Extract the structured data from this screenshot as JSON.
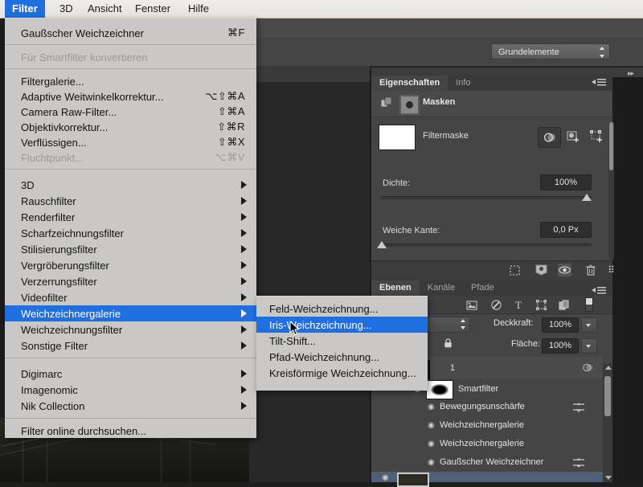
{
  "app": {
    "menubar": [
      {
        "label": "Filter",
        "active": true
      },
      {
        "label": "3D",
        "active": false
      },
      {
        "label": "Ansicht",
        "active": false
      },
      {
        "label": "Fenster",
        "active": false
      },
      {
        "label": "Hilfe",
        "active": false
      }
    ],
    "accent_color": "#1f6fe0",
    "menu_background": "#c9c8c6",
    "panel_background": "#454545"
  },
  "filter_menu": {
    "items": [
      {
        "label": "Gaußscher Weichzeichner",
        "shortcut": "⌘F",
        "submenu": false,
        "disabled": false,
        "selected": false
      },
      {
        "label": "Für Smartfilter konvertieren",
        "shortcut": "",
        "submenu": false,
        "disabled": true,
        "selected": false
      },
      {
        "label": "Filtergalerie...",
        "shortcut": "",
        "submenu": false,
        "disabled": false,
        "selected": false
      },
      {
        "label": "Adaptive Weitwinkelkorrektur...",
        "shortcut": "⌥⇧⌘A",
        "submenu": false,
        "disabled": false,
        "selected": false
      },
      {
        "label": "Camera Raw-Filter...",
        "shortcut": "⇧⌘A",
        "submenu": false,
        "disabled": false,
        "selected": false
      },
      {
        "label": "Objektivkorrektur...",
        "shortcut": "⇧⌘R",
        "submenu": false,
        "disabled": false,
        "selected": false
      },
      {
        "label": "Verflüssigen...",
        "shortcut": "⇧⌘X",
        "submenu": false,
        "disabled": false,
        "selected": false
      },
      {
        "label": "Fluchtpunkt...",
        "shortcut": "⌥⌘V",
        "submenu": false,
        "disabled": true,
        "selected": false
      },
      {
        "label": "3D",
        "shortcut": "",
        "submenu": true,
        "disabled": false,
        "selected": false
      },
      {
        "label": "Rauschfilter",
        "shortcut": "",
        "submenu": true,
        "disabled": false,
        "selected": false
      },
      {
        "label": "Renderfilter",
        "shortcut": "",
        "submenu": true,
        "disabled": false,
        "selected": false
      },
      {
        "label": "Scharfzeichnungsfilter",
        "shortcut": "",
        "submenu": true,
        "disabled": false,
        "selected": false
      },
      {
        "label": "Stilisierungsfilter",
        "shortcut": "",
        "submenu": true,
        "disabled": false,
        "selected": false
      },
      {
        "label": "Vergröberungsfilter",
        "shortcut": "",
        "submenu": true,
        "disabled": false,
        "selected": false
      },
      {
        "label": "Verzerrungsfilter",
        "shortcut": "",
        "submenu": true,
        "disabled": false,
        "selected": false
      },
      {
        "label": "Videofilter",
        "shortcut": "",
        "submenu": true,
        "disabled": false,
        "selected": false
      },
      {
        "label": "Weichzeichnergalerie",
        "shortcut": "",
        "submenu": true,
        "disabled": false,
        "selected": true
      },
      {
        "label": "Weichzeichnungsfilter",
        "shortcut": "",
        "submenu": true,
        "disabled": false,
        "selected": false
      },
      {
        "label": "Sonstige Filter",
        "shortcut": "",
        "submenu": true,
        "disabled": false,
        "selected": false
      },
      {
        "label": "Digimarc",
        "shortcut": "",
        "submenu": true,
        "disabled": false,
        "selected": false
      },
      {
        "label": "Imagenomic",
        "shortcut": "",
        "submenu": true,
        "disabled": false,
        "selected": false
      },
      {
        "label": "Nik Collection",
        "shortcut": "",
        "submenu": true,
        "disabled": false,
        "selected": false
      },
      {
        "label": "Filter online durchsuchen...",
        "shortcut": "",
        "submenu": false,
        "disabled": false,
        "selected": false
      }
    ]
  },
  "submenu": {
    "items": [
      {
        "label": "Feld-Weichzeichnung...",
        "selected": false
      },
      {
        "label": "Iris-Weichzeichnung...",
        "selected": true
      },
      {
        "label": "Tilt-Shift...",
        "selected": false
      },
      {
        "label": "Pfad-Weichzeichnung...",
        "selected": false
      },
      {
        "label": "Kreisförmige Weichzeichnung...",
        "selected": false
      }
    ]
  },
  "options_bar": {
    "workspace": "Grundelemente"
  },
  "properties_panel": {
    "tabs": [
      {
        "label": "Eigenschaften",
        "active": true
      },
      {
        "label": "Info",
        "active": false
      }
    ],
    "header": "Masken",
    "mask_name": "Filtermaske",
    "density": {
      "label": "Dichte:",
      "value": "100%",
      "percent": 100
    },
    "feather": {
      "label": "Weiche Kante:",
      "value": "0,0 Px",
      "percent": 0
    }
  },
  "layers_panel": {
    "tabs": [
      {
        "label": "Ebenen",
        "active": true
      },
      {
        "label": "Kanäle",
        "active": false
      },
      {
        "label": "Pfade",
        "active": false
      }
    ],
    "opacity": {
      "label": "Deckkraft:",
      "value": "100%"
    },
    "fill": {
      "label": "Fläche:",
      "value": "100%"
    },
    "layers": [
      {
        "name": "Smartfilter",
        "indent": 1,
        "type": "smart-filter-group"
      },
      {
        "name": "Bewegungsunschärfe",
        "indent": 2,
        "type": "filter"
      },
      {
        "name": "Weichzeichnergalerie",
        "indent": 2,
        "type": "filter"
      },
      {
        "name": "Weichzeichnergalerie",
        "indent": 2,
        "type": "filter"
      },
      {
        "name": "Gaußscher Weichzeichner",
        "indent": 2,
        "type": "filter"
      }
    ]
  }
}
